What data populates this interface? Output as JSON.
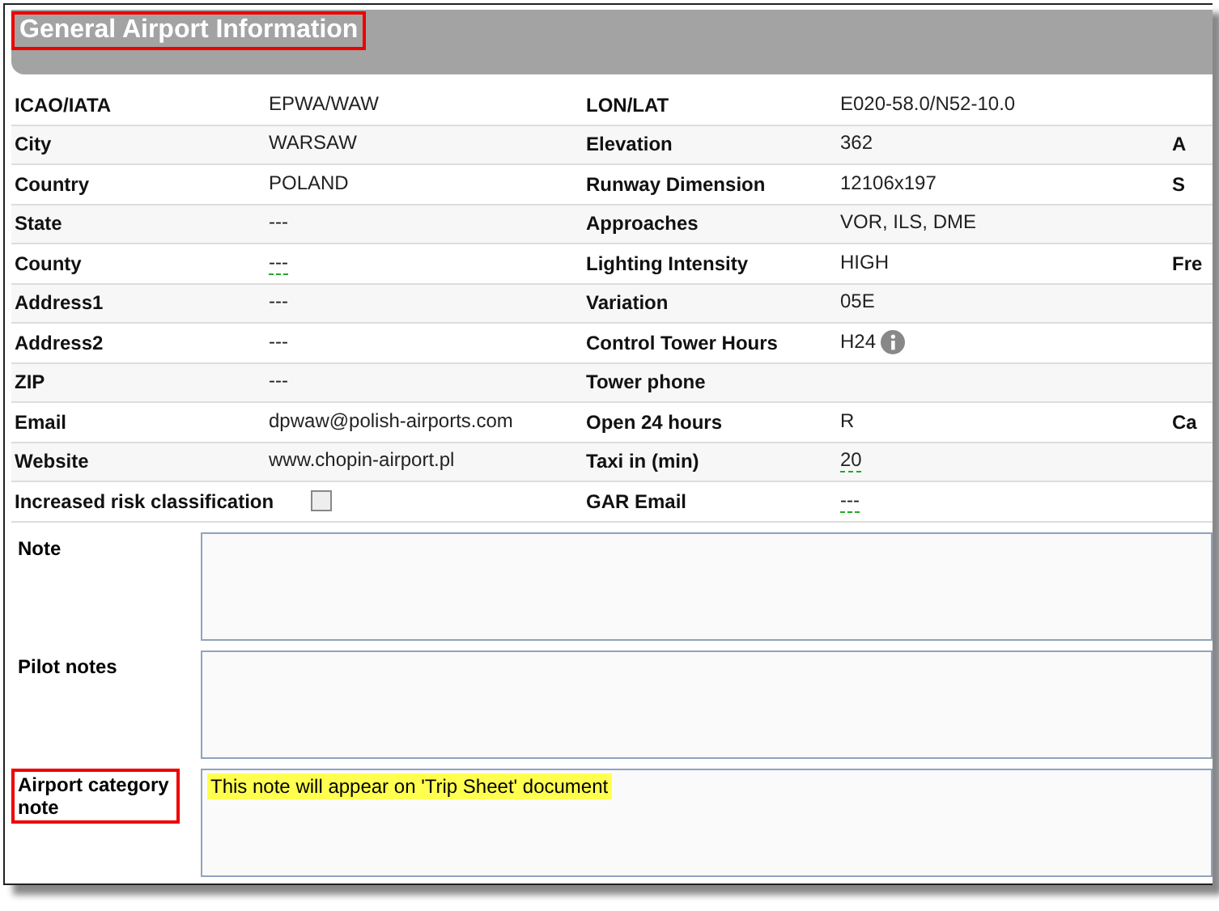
{
  "title": {
    "text": "General Airport Information",
    "highlighted": true
  },
  "rows": [
    {
      "kind": "text",
      "label": "ICAO/IATA",
      "value": "EPWA/WAW",
      "label2": "LON/LAT",
      "value2": "E020-58.0/N52-10.0"
    },
    {
      "kind": "text",
      "label": "City",
      "value": "WARSAW",
      "label2": "Elevation",
      "value2": "362",
      "column_3": "A"
    },
    {
      "kind": "text",
      "label": "Country",
      "value": "POLAND",
      "label2": "Runway Dimension",
      "value2": "12106x197",
      "column_3": "S"
    },
    {
      "kind": "text",
      "label": "State",
      "value": "---",
      "label2": "Approaches",
      "value2": "VOR, ILS, DME"
    },
    {
      "kind": "text",
      "label": "County",
      "value": "---",
      "value_underlined": true,
      "label2": "Lighting Intensity",
      "value2": "HIGH",
      "column_3": "Fre"
    },
    {
      "kind": "text",
      "label": "Address1",
      "value": "---",
      "label2": "Variation",
      "value2": "05E"
    },
    {
      "kind": "text",
      "label": "Address2",
      "value": "---",
      "label2": "Control Tower Hours",
      "value2": "H24",
      "info": true
    },
    {
      "kind": "text",
      "label": "ZIP",
      "value": "---",
      "label2": "Tower phone"
    },
    {
      "kind": "text",
      "label": "Email",
      "value": "dpwaw@polish-airports.com",
      "label2": "Open 24 hours",
      "value2": "R",
      "column_3": "Ca"
    },
    {
      "kind": "text",
      "label": "Website",
      "value": "www.chopin-airport.pl",
      "label2": "Taxi in (min)",
      "value2": "20",
      "value2_underlined": true
    },
    {
      "kind": "checkbox",
      "label": "Increased risk classification",
      "checked": false,
      "label2": "GAR Email",
      "value2": "---",
      "value2_underlined": true
    }
  ],
  "notes": [
    {
      "label": "Note",
      "highlighted": false
    },
    {
      "label": "Pilot notes",
      "highlighted": false
    },
    {
      "label": "Airport category note",
      "highlighted": true,
      "value": "This note will appear on 'Trip Sheet' document"
    }
  ]
}
